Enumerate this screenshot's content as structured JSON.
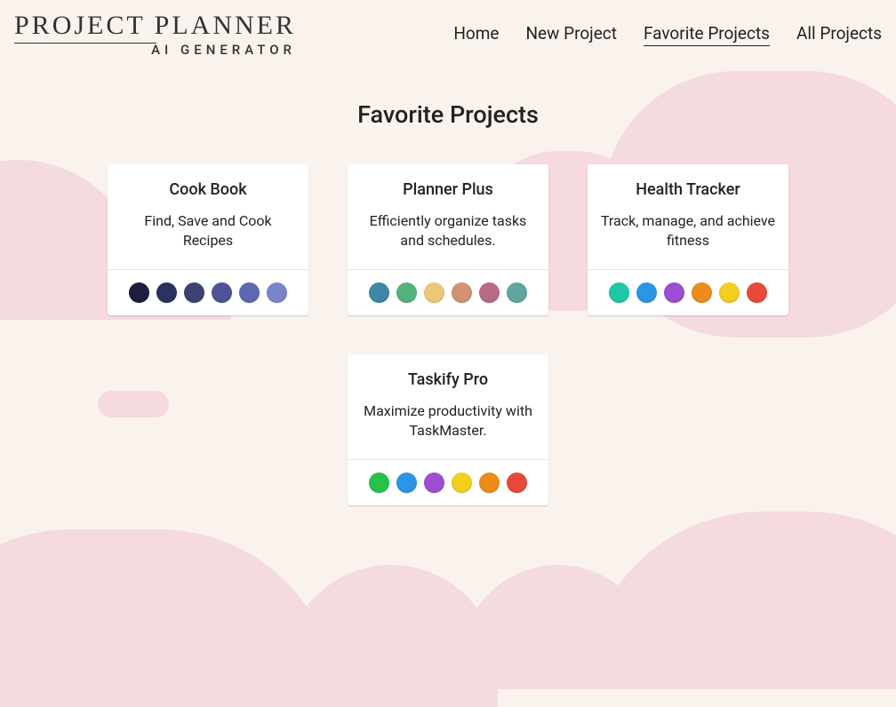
{
  "logo": {
    "title": "PROJECT PLANNER",
    "subtitle": "AI GENERATOR"
  },
  "nav": {
    "items": [
      {
        "label": "Home",
        "active": false
      },
      {
        "label": "New Project",
        "active": false
      },
      {
        "label": "Favorite Projects",
        "active": true
      },
      {
        "label": "All Projects",
        "active": false
      }
    ]
  },
  "page": {
    "title": "Favorite Projects"
  },
  "projects": [
    {
      "title": "Cook Book",
      "description": "Find, Save and Cook Recipes",
      "palette": [
        "#1b1e3f",
        "#2b3160",
        "#3b4375",
        "#4c5496",
        "#5d68b4",
        "#7a84ca"
      ]
    },
    {
      "title": "Planner Plus",
      "description": "Efficiently organize tasks and schedules.",
      "palette": [
        "#3d87a8",
        "#55b17e",
        "#eec677",
        "#d19275",
        "#b96a86",
        "#5fa6a0"
      ]
    },
    {
      "title": "Health Tracker",
      "description": "Track, manage, and achieve fitness",
      "palette": [
        "#1ec8a5",
        "#2c95e6",
        "#9c4fd1",
        "#ed8b1b",
        "#f5cf1f",
        "#e74a3b"
      ]
    },
    {
      "title": "Taskify Pro",
      "description": "Maximize productivity with TaskMaster.",
      "palette": [
        "#28c24a",
        "#2c95e6",
        "#9c4fd1",
        "#f5cf1f",
        "#ed8b1b",
        "#e74a3b"
      ]
    }
  ]
}
